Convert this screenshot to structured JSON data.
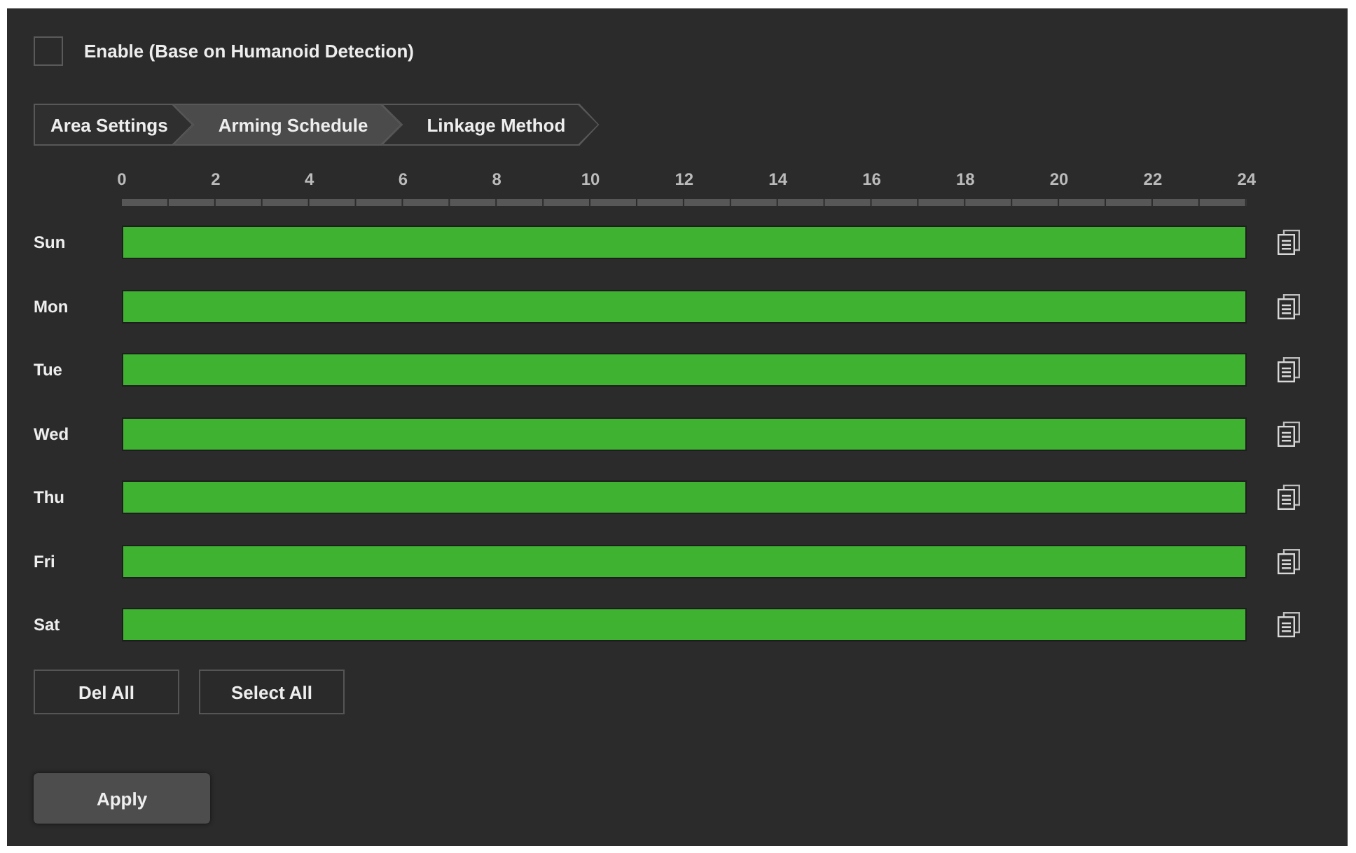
{
  "enable": {
    "label": "Enable (Base on Humanoid Detection)",
    "checked": false
  },
  "tabs": [
    {
      "label": "Area Settings",
      "selected": false
    },
    {
      "label": "Arming Schedule",
      "selected": true
    },
    {
      "label": "Linkage Method",
      "selected": false
    }
  ],
  "schedule": {
    "hours": [
      "0",
      "2",
      "4",
      "6",
      "8",
      "10",
      "12",
      "14",
      "16",
      "18",
      "20",
      "22",
      "24"
    ],
    "days": [
      {
        "name": "Sun",
        "level": 1
      },
      {
        "name": "Mon",
        "level": 1
      },
      {
        "name": "Tue",
        "level": 1
      },
      {
        "name": "Wed",
        "level": 1
      },
      {
        "name": "Thu",
        "level": 1
      },
      {
        "name": "Fri",
        "level": 1
      },
      {
        "name": "Sat",
        "level": 1
      }
    ]
  },
  "buttons": [
    {
      "label": "Del All"
    },
    {
      "label": "Select All"
    }
  ],
  "apply_button": {
    "label": "Apply"
  }
}
